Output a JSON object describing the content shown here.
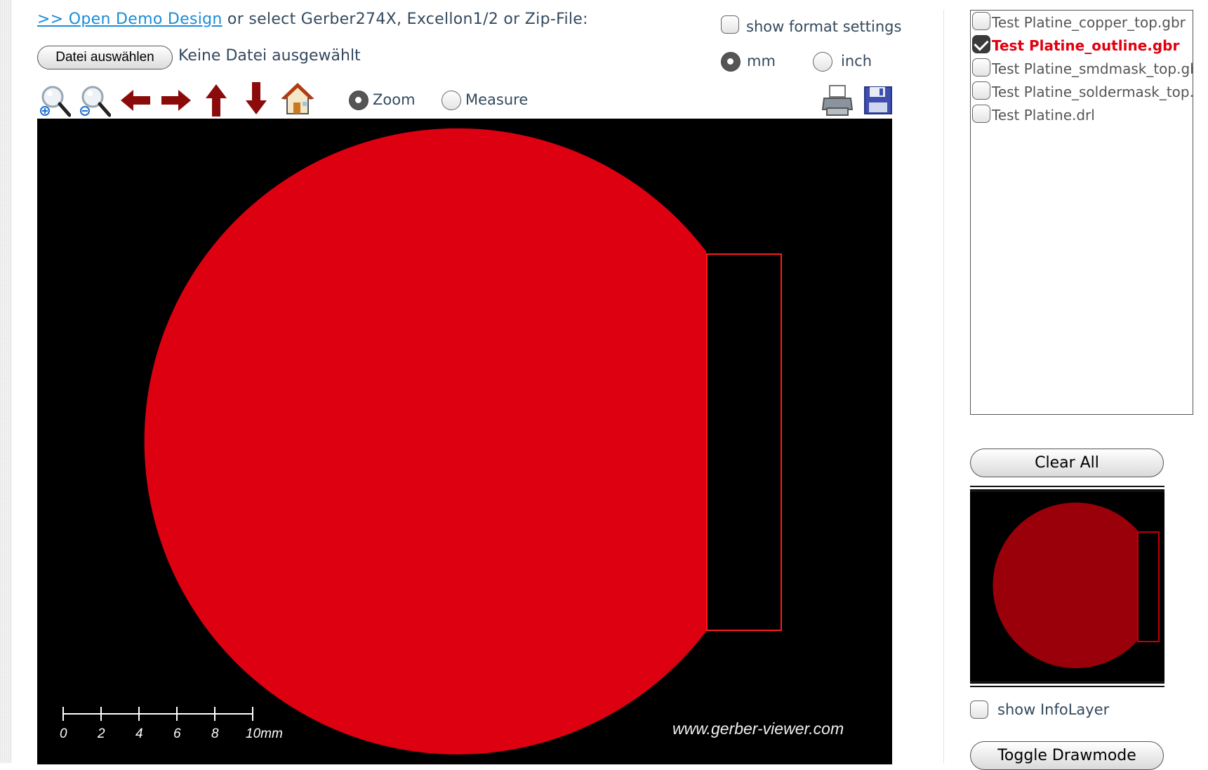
{
  "header": {
    "demo_link": ">> Open Demo Design",
    "select_text": " or select Gerber274X, Excellon1/2 or Zip-File:",
    "file_button": "Datei auswählen",
    "no_file": "Keine Datei ausgewählt",
    "show_format_settings": "show format settings",
    "unit_mm": "mm",
    "unit_inch": "inch",
    "unit_selected": "mm"
  },
  "toolbar": {
    "icons": [
      "zoom-in-icon",
      "zoom-out-icon",
      "arrow-left-icon",
      "arrow-right-icon",
      "arrow-up-icon",
      "arrow-down-icon",
      "home-icon",
      "print-icon",
      "save-icon"
    ],
    "mode_zoom": "Zoom",
    "mode_measure": "Measure",
    "mode_selected": "Zoom"
  },
  "viewer": {
    "background": "#000000",
    "fill_color": "#dd0010",
    "scale_labels": [
      "0",
      "2",
      "4",
      "6",
      "8",
      "10mm"
    ],
    "watermark": "www.gerber-viewer.com"
  },
  "layers": {
    "items": [
      {
        "name": "Test Platine_copper_top.gbr",
        "checked": false
      },
      {
        "name": "Test Platine_outline.gbr",
        "checked": true
      },
      {
        "name": "Test Platine_smdmask_top.gbr",
        "checked": false
      },
      {
        "name": "Test Platine_soldermask_top.gbr",
        "checked": false
      },
      {
        "name": "Test Platine.drl",
        "checked": false
      }
    ]
  },
  "sidebar": {
    "clear_all": "Clear All",
    "show_infolayer": "show InfoLayer",
    "toggle_drawmode": "Toggle Drawmode",
    "preview_color": "#9a000a"
  }
}
